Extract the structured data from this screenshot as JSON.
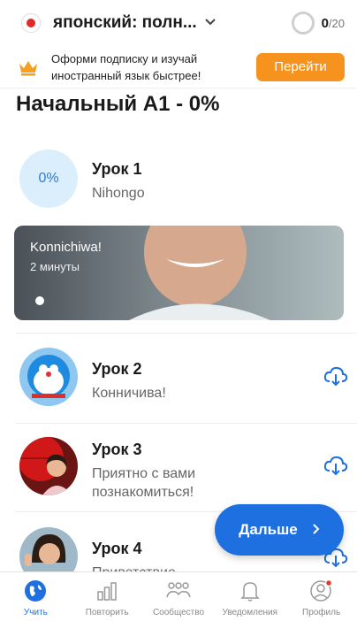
{
  "header": {
    "course_title": "японский: полн...",
    "progress_done": "0",
    "progress_total": "/20"
  },
  "promo": {
    "text": "Оформи подписку и изучай иностранный язык быстрее!",
    "button_label": "Перейти"
  },
  "level": {
    "title": "Начальный A1 - 0%"
  },
  "lessons": [
    {
      "name": "Урок 1",
      "subtitle": "Nihongo",
      "progress": "0%"
    },
    {
      "name": "Урок 2",
      "subtitle": "Конничива!"
    },
    {
      "name": "Урок 3",
      "subtitle": "Приятно с вами познакомиться!"
    },
    {
      "name": "Урок 4",
      "subtitle": "Приветствие"
    }
  ],
  "video": {
    "title": "Konnichiwa!",
    "duration": "2 минуты"
  },
  "next_button": {
    "label": "Дальше"
  },
  "nav": [
    {
      "label": "Учить",
      "icon": "globe-icon",
      "active": true
    },
    {
      "label": "Повторить",
      "icon": "chart-icon"
    },
    {
      "label": "Сообщество",
      "icon": "community-icon"
    },
    {
      "label": "Уведомления",
      "icon": "bell-icon"
    },
    {
      "label": "Профиль",
      "icon": "profile-icon"
    }
  ],
  "colors": {
    "accent": "#1e6fe0",
    "promo_button": "#f6921e",
    "flag_red": "#e02a2a"
  }
}
